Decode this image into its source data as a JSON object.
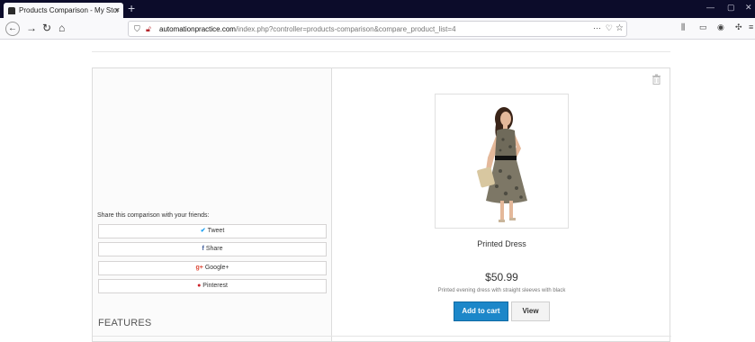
{
  "browser": {
    "tab_title": "Products Comparison - My Stor",
    "tab_close": "×",
    "new_tab": "+",
    "url_host": "automationpractice.com",
    "url_path": "/index.php?controller=products-comparison&compare_product_list=4",
    "url_more": "···",
    "win_min": "—",
    "win_restore": "▢",
    "win_close": "✕"
  },
  "icons": {
    "back": "back-arrow-icon",
    "forward": "forward-arrow-icon",
    "reload": "reload-icon",
    "home": "home-icon",
    "trash": "trash-icon"
  },
  "share": {
    "label": "Share this comparison with your friends:",
    "buttons": [
      {
        "icon": "twitter-icon",
        "glyph": "✔",
        "label": "Tweet",
        "color": "#1da1f2"
      },
      {
        "icon": "facebook-icon",
        "glyph": "f",
        "label": "Share",
        "color": "#3b5998"
      },
      {
        "icon": "googleplus-icon",
        "glyph": "g+",
        "label": "Google+",
        "color": "#dd4b39"
      },
      {
        "icon": "pinterest-icon",
        "glyph": "●",
        "label": "Pinterest",
        "color": "#cb2027"
      }
    ]
  },
  "features": {
    "heading": "FEATURES"
  },
  "product": {
    "name": "Printed Dress",
    "price": "$50.99",
    "description": "Printed evening dress with straight sleeves with black",
    "add_to_cart": "Add to cart",
    "view": "View"
  },
  "colors": {
    "accent": "#1c87c9",
    "tabbar": "#0c0c2a"
  }
}
